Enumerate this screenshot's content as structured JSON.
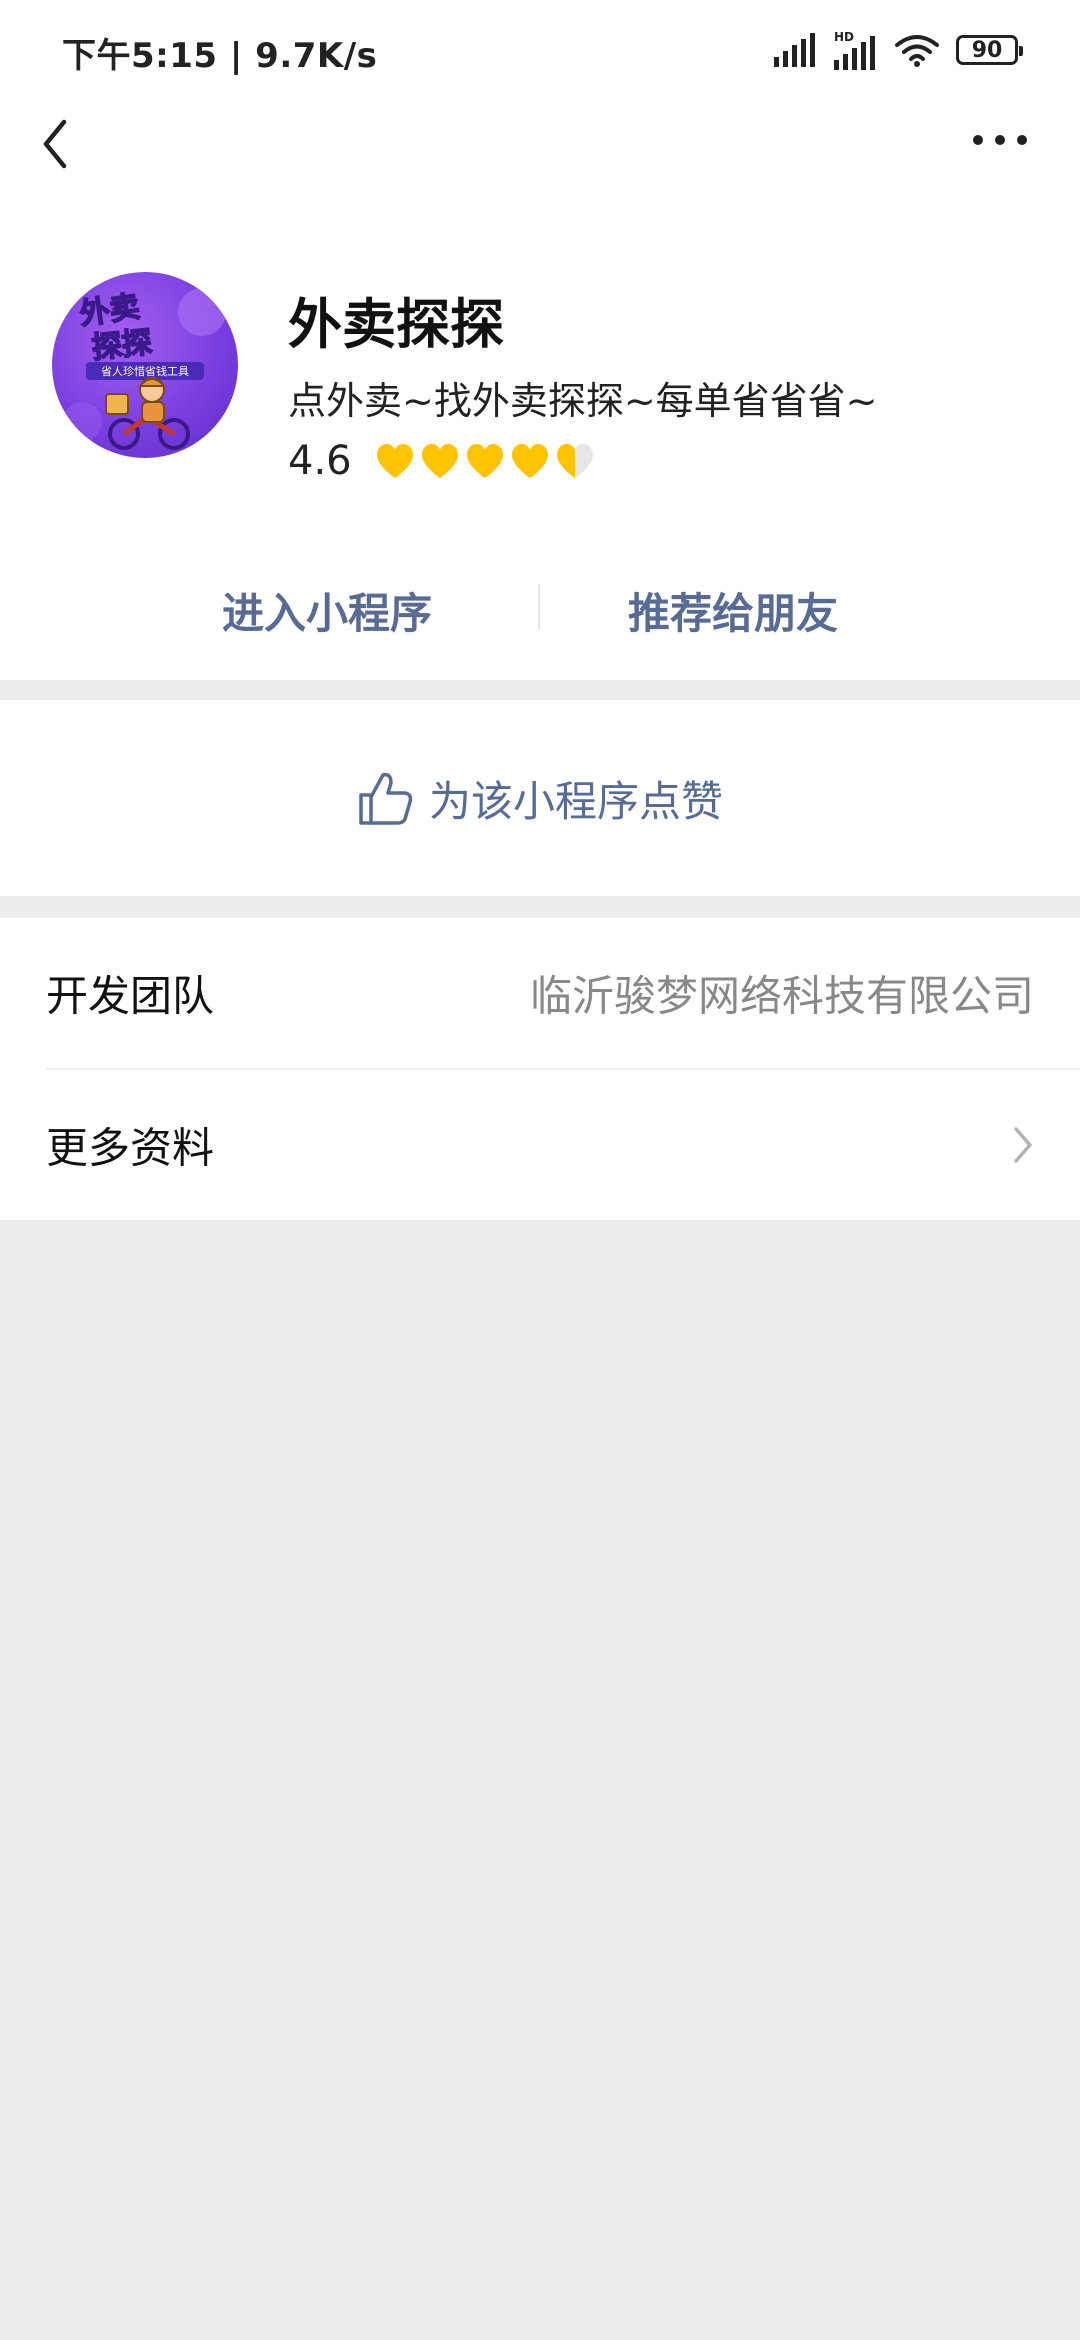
{
  "status_bar": {
    "time_speed": "下午5:15 | 9.7K/s",
    "hd_label": "HD",
    "battery": "90"
  },
  "nav": {
    "back_icon": "chevron-left-icon",
    "more_icon": "more-dots-icon"
  },
  "profile": {
    "name": "外卖探探",
    "description": "点外卖~找外卖探探~每单省省省~",
    "rating": "4.6",
    "rating_hearts": 4.6,
    "rating_max": 5,
    "avatar": {
      "title_line1": "外卖",
      "title_line2": "探探",
      "subtitle": "省人珍惜省钱工具",
      "bg_color": "#7b3fe0"
    }
  },
  "actions": {
    "enter_label": "进入小程序",
    "share_label": "推荐给朋友"
  },
  "like": {
    "label": "为该小程序点赞",
    "icon": "thumbs-up-icon"
  },
  "info": {
    "developer_label": "开发团队",
    "developer_value": "临沂骏梦网络科技有限公司",
    "more_label": "更多资料"
  },
  "colors": {
    "link_blue": "#576b95",
    "heart_yellow": "#ffc300",
    "background": "#ededed"
  }
}
